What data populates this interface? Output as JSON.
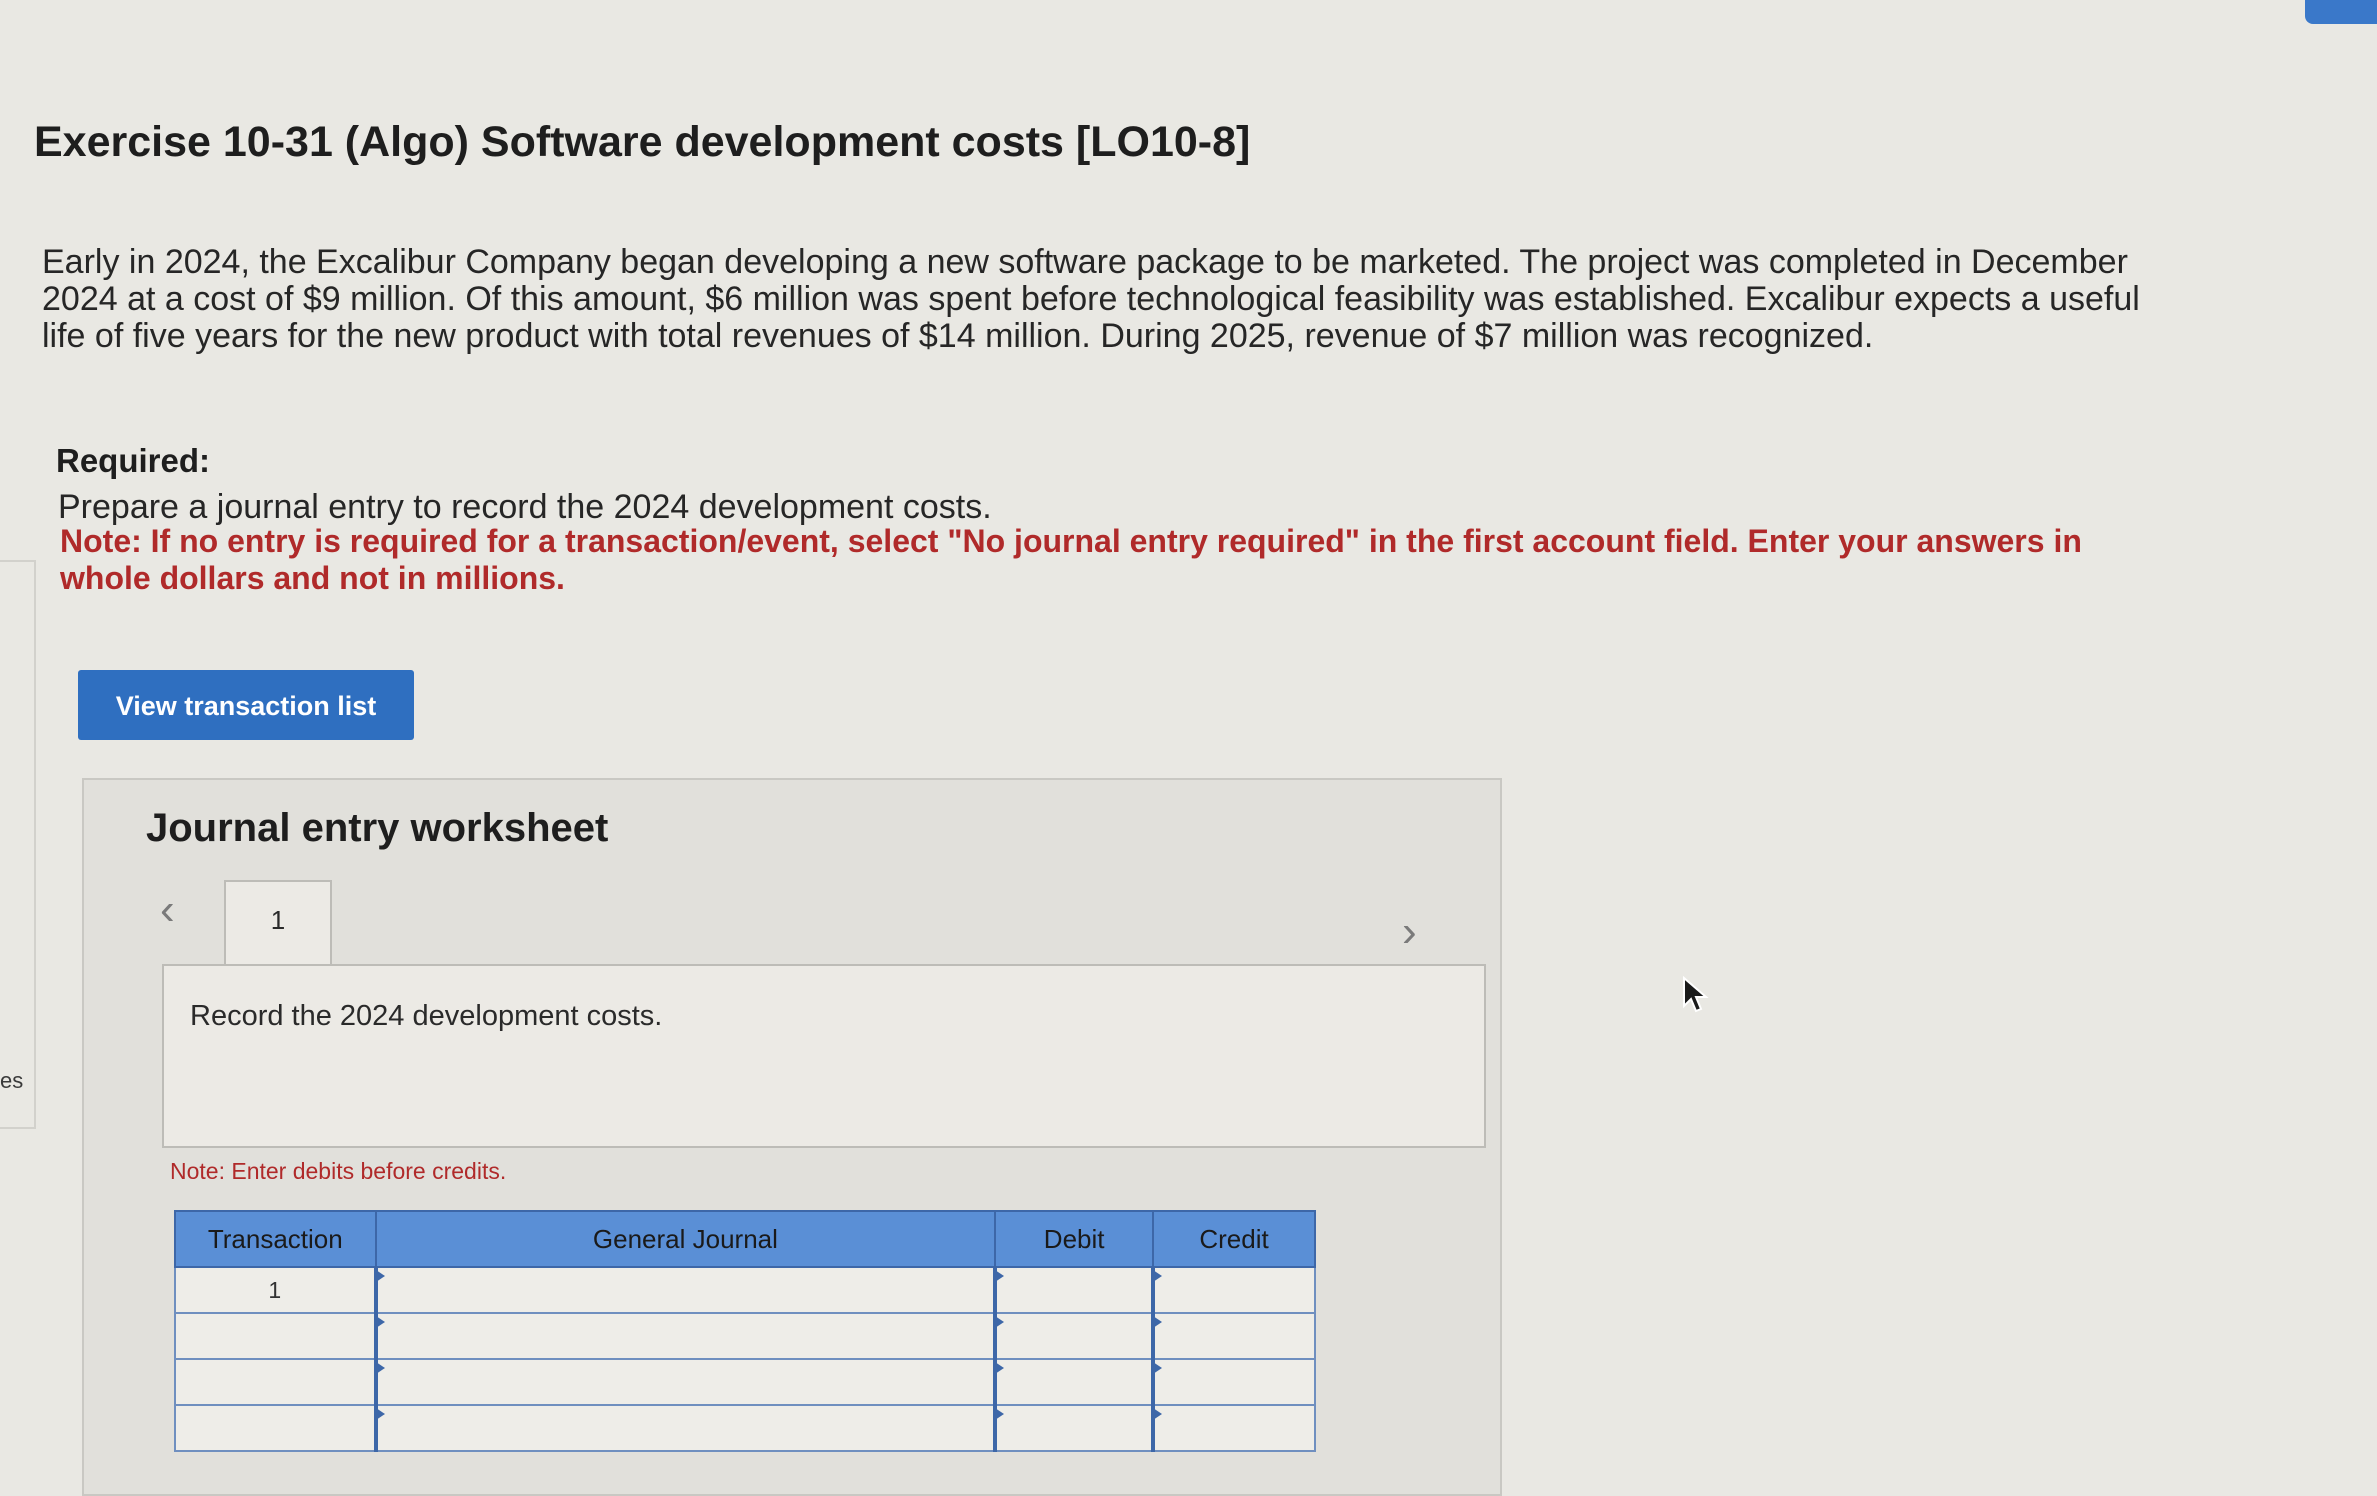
{
  "exercise": {
    "title": "Exercise 10-31 (Algo) Software development costs [LO10-8]",
    "problem": "Early in 2024, the Excalibur Company began developing a new software package to be marketed. The project was completed in December 2024 at a cost of $9 million. Of this amount, $6 million was spent before technological feasibility was established. Excalibur expects a useful life of five years for the new product with total revenues of $14 million. During 2025, revenue of $7 million was recognized.",
    "required_label": "Required:",
    "required_text": "Prepare a journal entry to record the 2024 development costs.",
    "note": "Note: If no entry is required for a transaction/event, select \"No journal entry required\" in the first account field. Enter your answers in whole dollars and not in millions."
  },
  "left_edge_text": "es",
  "view_button": "View transaction list",
  "worksheet": {
    "title": "Journal entry worksheet",
    "tab_label": "1",
    "record_text": "Record the 2024 development costs.",
    "debit_note": "Note: Enter debits before credits.",
    "columns": {
      "transaction": "Transaction",
      "general_journal": "General Journal",
      "debit": "Debit",
      "credit": "Credit"
    },
    "rows": [
      {
        "transaction": "1",
        "account": "",
        "debit": "",
        "credit": ""
      },
      {
        "transaction": "",
        "account": "",
        "debit": "",
        "credit": ""
      },
      {
        "transaction": "",
        "account": "",
        "debit": "",
        "credit": ""
      },
      {
        "transaction": "",
        "account": "",
        "debit": "",
        "credit": ""
      }
    ]
  },
  "colors": {
    "accent": "#2f6fc0",
    "note_red": "#b02a2a",
    "table_header": "#5a8fd6"
  },
  "icons": [
    "chevron-left-icon",
    "chevron-right-icon",
    "mouse-cursor-icon"
  ]
}
